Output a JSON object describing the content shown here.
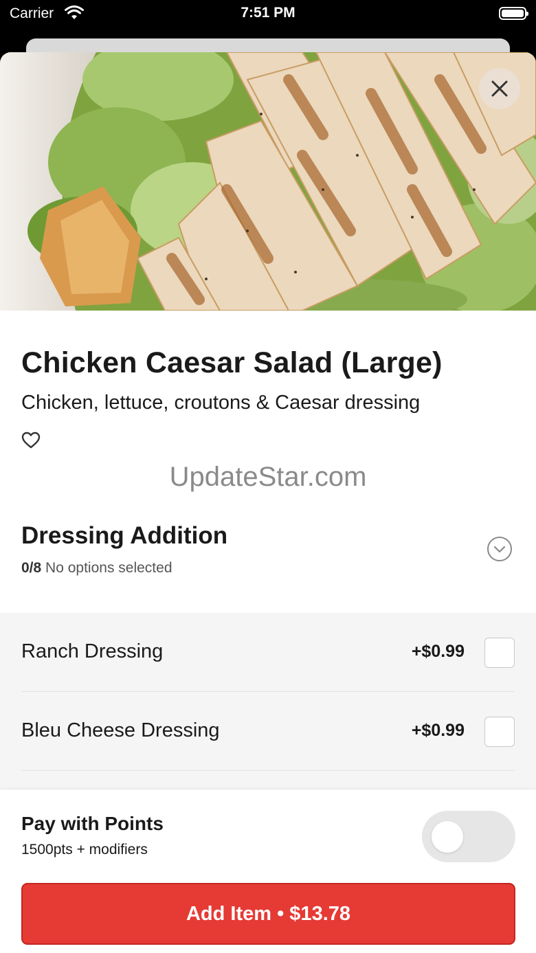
{
  "status_bar": {
    "carrier": "Carrier",
    "time": "7:51 PM"
  },
  "item": {
    "title": "Chicken Caesar Salad (Large)",
    "description": "Chicken, lettuce, croutons & Caesar dressing"
  },
  "watermark": "UpdateStar.com",
  "section": {
    "title": "Dressing Addition",
    "count": "0/8",
    "status": "No options selected"
  },
  "options": [
    {
      "name": "Ranch Dressing",
      "price": "+$0.99",
      "selected": false
    },
    {
      "name": "Bleu Cheese Dressing",
      "price": "+$0.99",
      "selected": false
    }
  ],
  "footer": {
    "pay_title": "Pay with Points",
    "pay_sub": "1500pts + modifiers",
    "toggle_on": false,
    "add_button": "Add Item • $13.78"
  },
  "colors": {
    "accent": "#e63a35",
    "sheet_bg": "#ffffff",
    "options_bg": "#f5f5f5"
  },
  "icons": [
    "wifi-icon",
    "battery-icon",
    "close-icon",
    "heart-icon",
    "chevron-down-icon"
  ]
}
